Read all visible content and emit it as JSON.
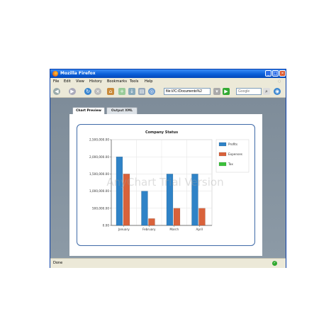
{
  "window": {
    "title": "Mozilla Firefox"
  },
  "menu": [
    "File",
    "Edit",
    "View",
    "History",
    "Bookmarks",
    "Tools",
    "Help"
  ],
  "address": {
    "value": "file:///C:/Documents%2",
    "search_placeholder": "Google"
  },
  "tabs": [
    {
      "label": "Chart Preview",
      "active": true
    },
    {
      "label": "Output XML",
      "active": false
    }
  ],
  "status": {
    "text": "Done"
  },
  "colors": {
    "profits": "#2f83c7",
    "expenses": "#d9623b",
    "tax": "#3cc13c"
  },
  "chart_data": {
    "type": "bar",
    "title": "Company Status",
    "categories": [
      "January",
      "February",
      "March",
      "April"
    ],
    "series": [
      {
        "name": "Profits",
        "values": [
          2000000,
          1000000,
          1500000,
          1500000
        ]
      },
      {
        "name": "Expenses",
        "values": [
          1500000,
          200000,
          500000,
          500000
        ]
      },
      {
        "name": "Tax",
        "values": [
          0,
          0,
          0,
          0
        ]
      }
    ],
    "ylim": [
      0,
      2500000
    ],
    "yticks": [
      "0.00",
      "500,000.00",
      "1,000,000.00",
      "1,500,000.00",
      "2,000,000.00",
      "2,500,000.00"
    ],
    "grid": true,
    "legend": "right",
    "watermark": "AnyChart Trial Version"
  }
}
